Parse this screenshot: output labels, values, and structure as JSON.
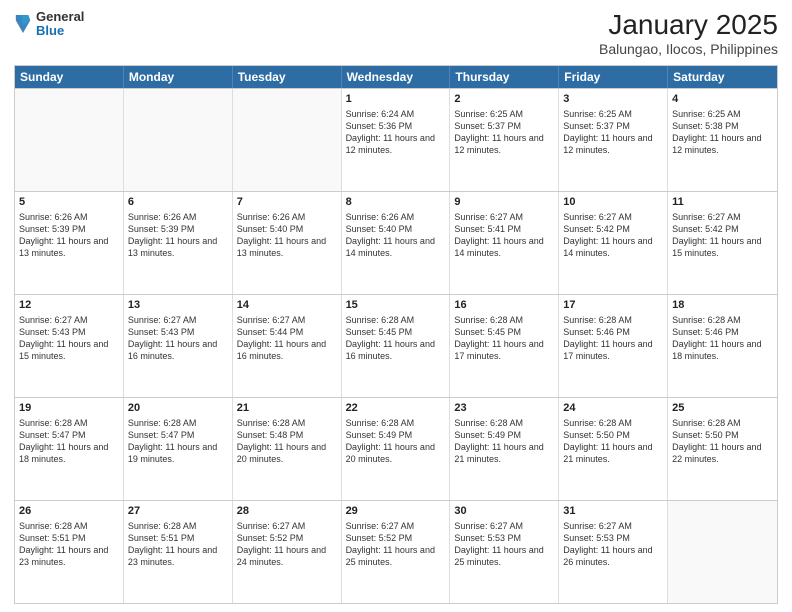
{
  "header": {
    "logo_general": "General",
    "logo_blue": "Blue",
    "title": "January 2025",
    "subtitle": "Balungao, Ilocos, Philippines"
  },
  "days_of_week": [
    "Sunday",
    "Monday",
    "Tuesday",
    "Wednesday",
    "Thursday",
    "Friday",
    "Saturday"
  ],
  "weeks": [
    [
      {
        "day": "",
        "sunrise": "",
        "sunset": "",
        "daylight": "",
        "empty": true
      },
      {
        "day": "",
        "sunrise": "",
        "sunset": "",
        "daylight": "",
        "empty": true
      },
      {
        "day": "",
        "sunrise": "",
        "sunset": "",
        "daylight": "",
        "empty": true
      },
      {
        "day": "1",
        "sunrise": "Sunrise: 6:24 AM",
        "sunset": "Sunset: 5:36 PM",
        "daylight": "Daylight: 11 hours and 12 minutes.",
        "empty": false
      },
      {
        "day": "2",
        "sunrise": "Sunrise: 6:25 AM",
        "sunset": "Sunset: 5:37 PM",
        "daylight": "Daylight: 11 hours and 12 minutes.",
        "empty": false
      },
      {
        "day": "3",
        "sunrise": "Sunrise: 6:25 AM",
        "sunset": "Sunset: 5:37 PM",
        "daylight": "Daylight: 11 hours and 12 minutes.",
        "empty": false
      },
      {
        "day": "4",
        "sunrise": "Sunrise: 6:25 AM",
        "sunset": "Sunset: 5:38 PM",
        "daylight": "Daylight: 11 hours and 12 minutes.",
        "empty": false
      }
    ],
    [
      {
        "day": "5",
        "sunrise": "Sunrise: 6:26 AM",
        "sunset": "Sunset: 5:39 PM",
        "daylight": "Daylight: 11 hours and 13 minutes.",
        "empty": false
      },
      {
        "day": "6",
        "sunrise": "Sunrise: 6:26 AM",
        "sunset": "Sunset: 5:39 PM",
        "daylight": "Daylight: 11 hours and 13 minutes.",
        "empty": false
      },
      {
        "day": "7",
        "sunrise": "Sunrise: 6:26 AM",
        "sunset": "Sunset: 5:40 PM",
        "daylight": "Daylight: 11 hours and 13 minutes.",
        "empty": false
      },
      {
        "day": "8",
        "sunrise": "Sunrise: 6:26 AM",
        "sunset": "Sunset: 5:40 PM",
        "daylight": "Daylight: 11 hours and 14 minutes.",
        "empty": false
      },
      {
        "day": "9",
        "sunrise": "Sunrise: 6:27 AM",
        "sunset": "Sunset: 5:41 PM",
        "daylight": "Daylight: 11 hours and 14 minutes.",
        "empty": false
      },
      {
        "day": "10",
        "sunrise": "Sunrise: 6:27 AM",
        "sunset": "Sunset: 5:42 PM",
        "daylight": "Daylight: 11 hours and 14 minutes.",
        "empty": false
      },
      {
        "day": "11",
        "sunrise": "Sunrise: 6:27 AM",
        "sunset": "Sunset: 5:42 PM",
        "daylight": "Daylight: 11 hours and 15 minutes.",
        "empty": false
      }
    ],
    [
      {
        "day": "12",
        "sunrise": "Sunrise: 6:27 AM",
        "sunset": "Sunset: 5:43 PM",
        "daylight": "Daylight: 11 hours and 15 minutes.",
        "empty": false
      },
      {
        "day": "13",
        "sunrise": "Sunrise: 6:27 AM",
        "sunset": "Sunset: 5:43 PM",
        "daylight": "Daylight: 11 hours and 16 minutes.",
        "empty": false
      },
      {
        "day": "14",
        "sunrise": "Sunrise: 6:27 AM",
        "sunset": "Sunset: 5:44 PM",
        "daylight": "Daylight: 11 hours and 16 minutes.",
        "empty": false
      },
      {
        "day": "15",
        "sunrise": "Sunrise: 6:28 AM",
        "sunset": "Sunset: 5:45 PM",
        "daylight": "Daylight: 11 hours and 16 minutes.",
        "empty": false
      },
      {
        "day": "16",
        "sunrise": "Sunrise: 6:28 AM",
        "sunset": "Sunset: 5:45 PM",
        "daylight": "Daylight: 11 hours and 17 minutes.",
        "empty": false
      },
      {
        "day": "17",
        "sunrise": "Sunrise: 6:28 AM",
        "sunset": "Sunset: 5:46 PM",
        "daylight": "Daylight: 11 hours and 17 minutes.",
        "empty": false
      },
      {
        "day": "18",
        "sunrise": "Sunrise: 6:28 AM",
        "sunset": "Sunset: 5:46 PM",
        "daylight": "Daylight: 11 hours and 18 minutes.",
        "empty": false
      }
    ],
    [
      {
        "day": "19",
        "sunrise": "Sunrise: 6:28 AM",
        "sunset": "Sunset: 5:47 PM",
        "daylight": "Daylight: 11 hours and 18 minutes.",
        "empty": false
      },
      {
        "day": "20",
        "sunrise": "Sunrise: 6:28 AM",
        "sunset": "Sunset: 5:47 PM",
        "daylight": "Daylight: 11 hours and 19 minutes.",
        "empty": false
      },
      {
        "day": "21",
        "sunrise": "Sunrise: 6:28 AM",
        "sunset": "Sunset: 5:48 PM",
        "daylight": "Daylight: 11 hours and 20 minutes.",
        "empty": false
      },
      {
        "day": "22",
        "sunrise": "Sunrise: 6:28 AM",
        "sunset": "Sunset: 5:49 PM",
        "daylight": "Daylight: 11 hours and 20 minutes.",
        "empty": false
      },
      {
        "day": "23",
        "sunrise": "Sunrise: 6:28 AM",
        "sunset": "Sunset: 5:49 PM",
        "daylight": "Daylight: 11 hours and 21 minutes.",
        "empty": false
      },
      {
        "day": "24",
        "sunrise": "Sunrise: 6:28 AM",
        "sunset": "Sunset: 5:50 PM",
        "daylight": "Daylight: 11 hours and 21 minutes.",
        "empty": false
      },
      {
        "day": "25",
        "sunrise": "Sunrise: 6:28 AM",
        "sunset": "Sunset: 5:50 PM",
        "daylight": "Daylight: 11 hours and 22 minutes.",
        "empty": false
      }
    ],
    [
      {
        "day": "26",
        "sunrise": "Sunrise: 6:28 AM",
        "sunset": "Sunset: 5:51 PM",
        "daylight": "Daylight: 11 hours and 23 minutes.",
        "empty": false
      },
      {
        "day": "27",
        "sunrise": "Sunrise: 6:28 AM",
        "sunset": "Sunset: 5:51 PM",
        "daylight": "Daylight: 11 hours and 23 minutes.",
        "empty": false
      },
      {
        "day": "28",
        "sunrise": "Sunrise: 6:27 AM",
        "sunset": "Sunset: 5:52 PM",
        "daylight": "Daylight: 11 hours and 24 minutes.",
        "empty": false
      },
      {
        "day": "29",
        "sunrise": "Sunrise: 6:27 AM",
        "sunset": "Sunset: 5:52 PM",
        "daylight": "Daylight: 11 hours and 25 minutes.",
        "empty": false
      },
      {
        "day": "30",
        "sunrise": "Sunrise: 6:27 AM",
        "sunset": "Sunset: 5:53 PM",
        "daylight": "Daylight: 11 hours and 25 minutes.",
        "empty": false
      },
      {
        "day": "31",
        "sunrise": "Sunrise: 6:27 AM",
        "sunset": "Sunset: 5:53 PM",
        "daylight": "Daylight: 11 hours and 26 minutes.",
        "empty": false
      },
      {
        "day": "",
        "sunrise": "",
        "sunset": "",
        "daylight": "",
        "empty": true
      }
    ]
  ]
}
